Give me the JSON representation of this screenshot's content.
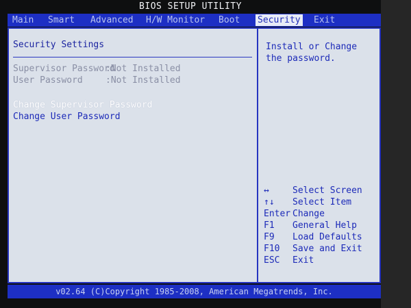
{
  "title": "BIOS SETUP UTILITY",
  "menu": [
    {
      "label": "Main"
    },
    {
      "label": "Smart"
    },
    {
      "label": "Advanced"
    },
    {
      "label": "H/W Monitor"
    },
    {
      "label": "Boot"
    },
    {
      "label": "Security",
      "active": true
    },
    {
      "label": "Exit"
    }
  ],
  "section_title": "Security Settings",
  "status": [
    {
      "label": "Supervisor Password",
      "value": ":Not Installed"
    },
    {
      "label": "User Password",
      "value": ":Not Installed"
    }
  ],
  "options": [
    {
      "label": "Change Supervisor Password",
      "selected": true
    },
    {
      "label": "Change User Password",
      "selected": false
    }
  ],
  "help_text": "Install or Change the password.",
  "keys": [
    {
      "key": "↔",
      "desc": "Select Screen"
    },
    {
      "key": "↑↓",
      "desc": "Select Item"
    },
    {
      "key": "Enter",
      "desc": "Change"
    },
    {
      "key": "F1",
      "desc": "General Help"
    },
    {
      "key": "F9",
      "desc": "Load Defaults"
    },
    {
      "key": "F10",
      "desc": "Save and Exit"
    },
    {
      "key": "ESC",
      "desc": "Exit"
    }
  ],
  "footer": "v02.64 (C)Copyright 1985-2008, American Megatrends, Inc.",
  "colors": {
    "bar_blue": "#1d2fc4",
    "panel_bg": "#dbe1ea",
    "text_blue": "#1c2ab8",
    "selected_text": "#ffffff"
  }
}
